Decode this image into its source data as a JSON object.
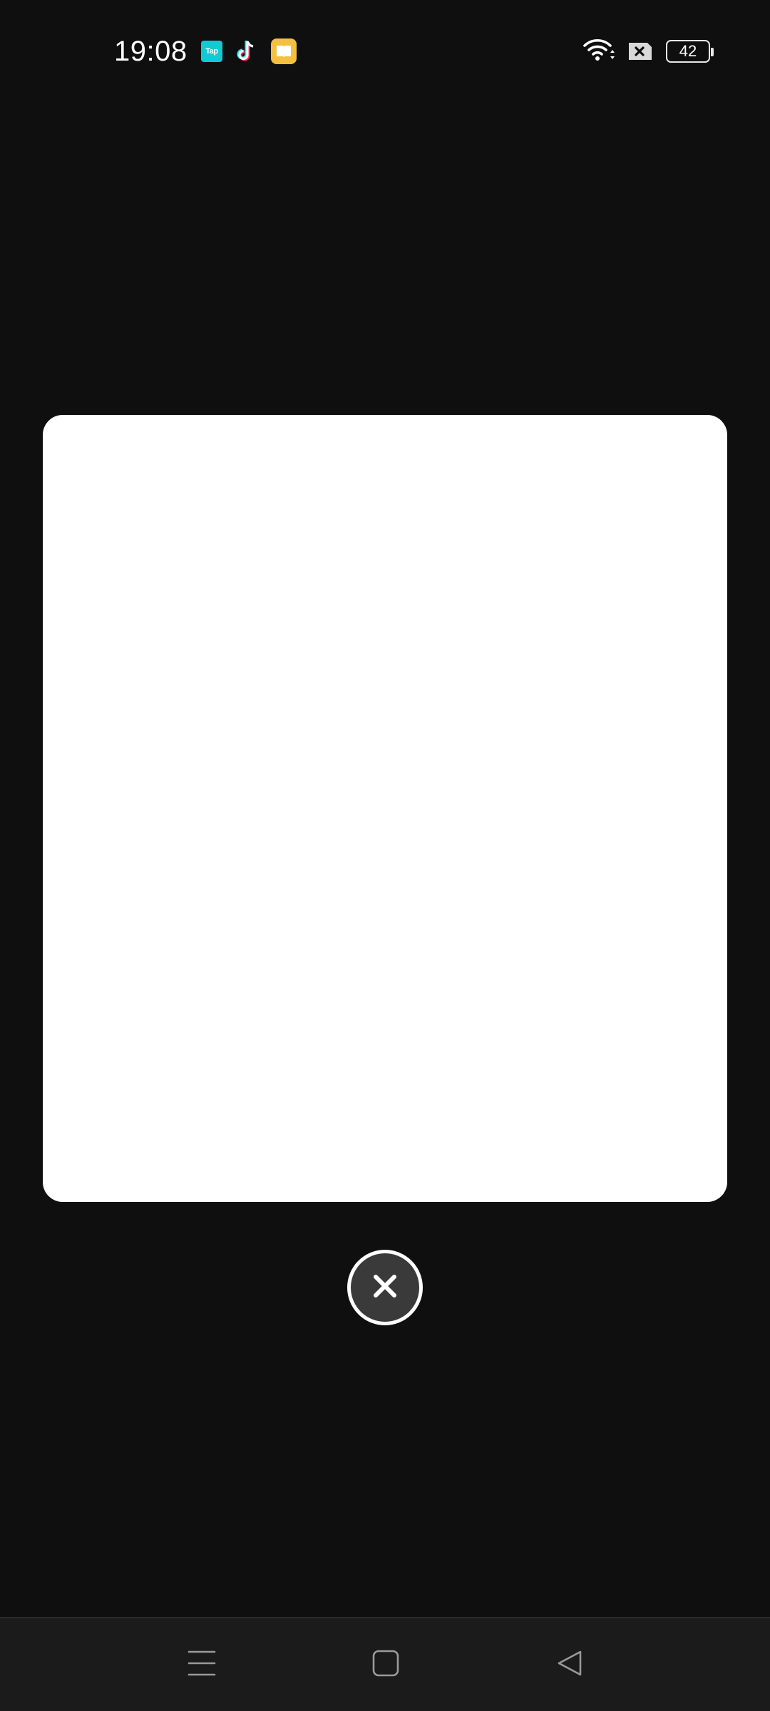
{
  "status_bar": {
    "time": "19:08",
    "notification_icons": [
      "taptap-icon",
      "tiktok-icon",
      "reader-icon"
    ],
    "taptap_label": "Tap",
    "wifi": "wifi-icon",
    "sim": "no-sim-icon",
    "battery_level": "42"
  },
  "dialog": {
    "close_icon": "close-icon"
  },
  "navigation": {
    "buttons": [
      "menu-icon",
      "home-icon",
      "back-icon"
    ]
  },
  "colors": {
    "background": "#0f0f10",
    "card": "#ffffff",
    "close_button_fill": "#3a3a3a",
    "nav_bar": "#1b1b1c",
    "taptap": "#14c8d4",
    "reader": "#f4c040"
  }
}
